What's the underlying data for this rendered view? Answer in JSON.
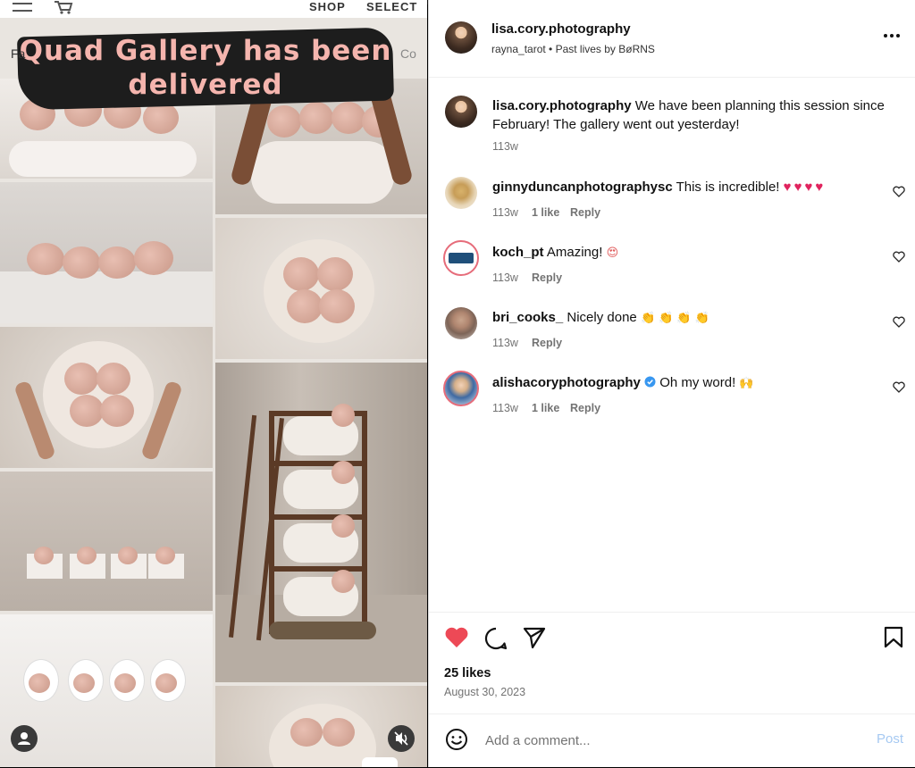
{
  "media": {
    "shop_label": "SHOP",
    "select_label": "SELECT",
    "fa_label": "Fa",
    "co_label": "Co",
    "banner_line1": "Quad Gallery has been",
    "banner_line2": "delivered"
  },
  "post": {
    "author": "lisa.cory.photography",
    "subline": "rayna_tarot • Past lives by BøRNS",
    "caption_author": "lisa.cory.photography",
    "caption_text": "We have been planning this session since February! The gallery went out yesterday!",
    "caption_time": "113w",
    "likes": "25 likes",
    "date": "August 30, 2023"
  },
  "comments": [
    {
      "user": "ginnyduncanphotographysc",
      "text": "This is incredible!",
      "emoji": "♥♥♥♥",
      "time": "113w",
      "likes": "1 like",
      "reply": "Reply"
    },
    {
      "user": "koch_pt",
      "text": "Amazing!",
      "emoji": "😍",
      "time": "113w",
      "likes": "",
      "reply": "Reply"
    },
    {
      "user": "bri_cooks_",
      "text": "Nicely done",
      "emoji": "👏👏👏👏",
      "time": "113w",
      "likes": "",
      "reply": "Reply"
    },
    {
      "user": "alishacoryphotography",
      "text": "Oh my word!",
      "emoji": "🙌",
      "time": "113w",
      "likes": "1 like",
      "reply": "Reply"
    }
  ],
  "add_comment": {
    "placeholder": "Add a comment...",
    "post_label": "Post"
  },
  "colors": {
    "like_red": "#ed4956",
    "link_blue": "#a6c9f2",
    "verified_blue": "#3897f0"
  }
}
